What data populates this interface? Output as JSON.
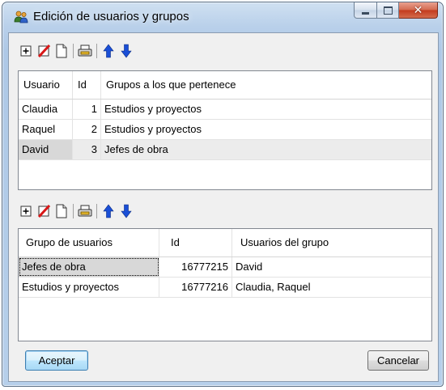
{
  "window": {
    "title": "Edición de usuarios y grupos"
  },
  "icons": {
    "app": "users-icon",
    "toolbar": [
      "add-icon",
      "delete-icon",
      "copy-icon",
      "print-icon",
      "arrow-up-icon",
      "arrow-down-icon"
    ]
  },
  "colors": {
    "arrow_blue": "#1a4fd6",
    "delete_red": "#d81818",
    "selection_gray": "#d8d8d8"
  },
  "users_grid": {
    "columns": [
      "Usuario",
      "Id",
      "Grupos a los que pertenece"
    ],
    "rows": [
      {
        "usuario": "Claudia",
        "id": "1",
        "grupos": "Estudios y proyectos"
      },
      {
        "usuario": "Raquel",
        "id": "2",
        "grupos": "Estudios y proyectos"
      },
      {
        "usuario": "David",
        "id": "3",
        "grupos": "Jefes de obra"
      }
    ]
  },
  "groups_grid": {
    "columns": [
      "Grupo de usuarios",
      "Id",
      "Usuarios del grupo"
    ],
    "rows": [
      {
        "grupo": "Jefes de obra",
        "id": "16777215",
        "usuarios": "David"
      },
      {
        "grupo": "Estudios y proyectos",
        "id": "16777216",
        "usuarios": "Claudia, Raquel"
      }
    ]
  },
  "buttons": {
    "accept": "Aceptar",
    "cancel": "Cancelar"
  }
}
